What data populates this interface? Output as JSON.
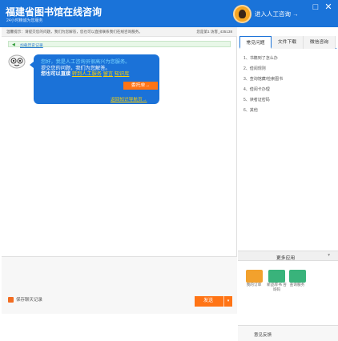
{
  "header": {
    "title": "福建省图书馆在线咨询",
    "subtitle": "24小时精诚为您服务",
    "agent_link": "进入人工咨询 →",
    "minimize": "□",
    "close": "✕"
  },
  "infobar": {
    "text": "温馨提示：请提交您的问题，我们为您解答，您也可以直接联系我们在线咨询服务。",
    "visitor": "您是第1 访客_435138"
  },
  "chat": {
    "history_link": "加载历史记录",
    "greeting": "您好，我是人工咨询员很高兴为您服务。",
    "line2": "提交您的问题，我们为您解答。",
    "line3_prefix": "您也可以直接",
    "link_human": "转到人工服务",
    "link_message": "留言",
    "link_knowledge": "知识库",
    "entrust": "委托单→",
    "return_link": "返回知识导航页→"
  },
  "composer": {
    "save_label": "保存聊天记录",
    "send_label": "发送",
    "send_dropdown": "▾"
  },
  "side": {
    "tabs": [
      "常见问题",
      "文件下载",
      "微信咨询"
    ],
    "faq": [
      "1、书籍到了怎么办",
      "2、借阅规则",
      "3、查询馆藏/检索图书",
      "4、借阅卡办理",
      "5、读者证密码",
      "6、其他"
    ],
    "apps_title": "更多应用",
    "apps_chevron": "▾",
    "apps": [
      {
        "label": "我的订单",
        "color": "#f2a12d"
      },
      {
        "label": "新品荐书 咨询码",
        "color": "#39b37b"
      },
      {
        "label": "查询服务",
        "color": "#39b37b"
      }
    ],
    "feedback": "意见反馈"
  }
}
